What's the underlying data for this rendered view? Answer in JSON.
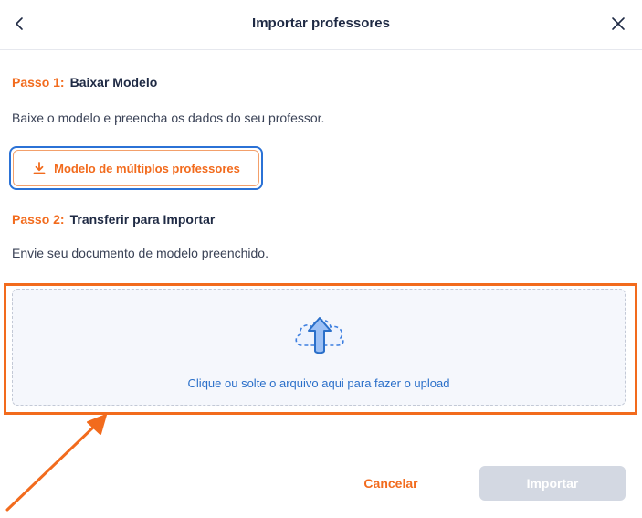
{
  "header": {
    "title": "Importar professores",
    "back_icon": "chevron-left-icon",
    "close_icon": "close-icon"
  },
  "step1": {
    "label": "Passo 1:",
    "title": "Baixar Modelo",
    "description": "Baixe o modelo e preencha os dados do seu professor.",
    "button_label": "Modelo de múltiplos professores",
    "button_icon": "download-icon"
  },
  "step2": {
    "label": "Passo 2:",
    "title": "Transferir para Importar",
    "description": "Envie seu documento de modelo preenchido."
  },
  "upload": {
    "icon": "cloud-upload-icon",
    "text": "Clique ou solte o arquivo aqui para fazer o upload"
  },
  "footer": {
    "cancel_label": "Cancelar",
    "import_label": "Importar"
  },
  "colors": {
    "accent_orange": "#f26b1d",
    "link_blue": "#2a6fc9",
    "focus_blue": "#2b72d6",
    "disabled_gray": "#d3d8e2"
  }
}
